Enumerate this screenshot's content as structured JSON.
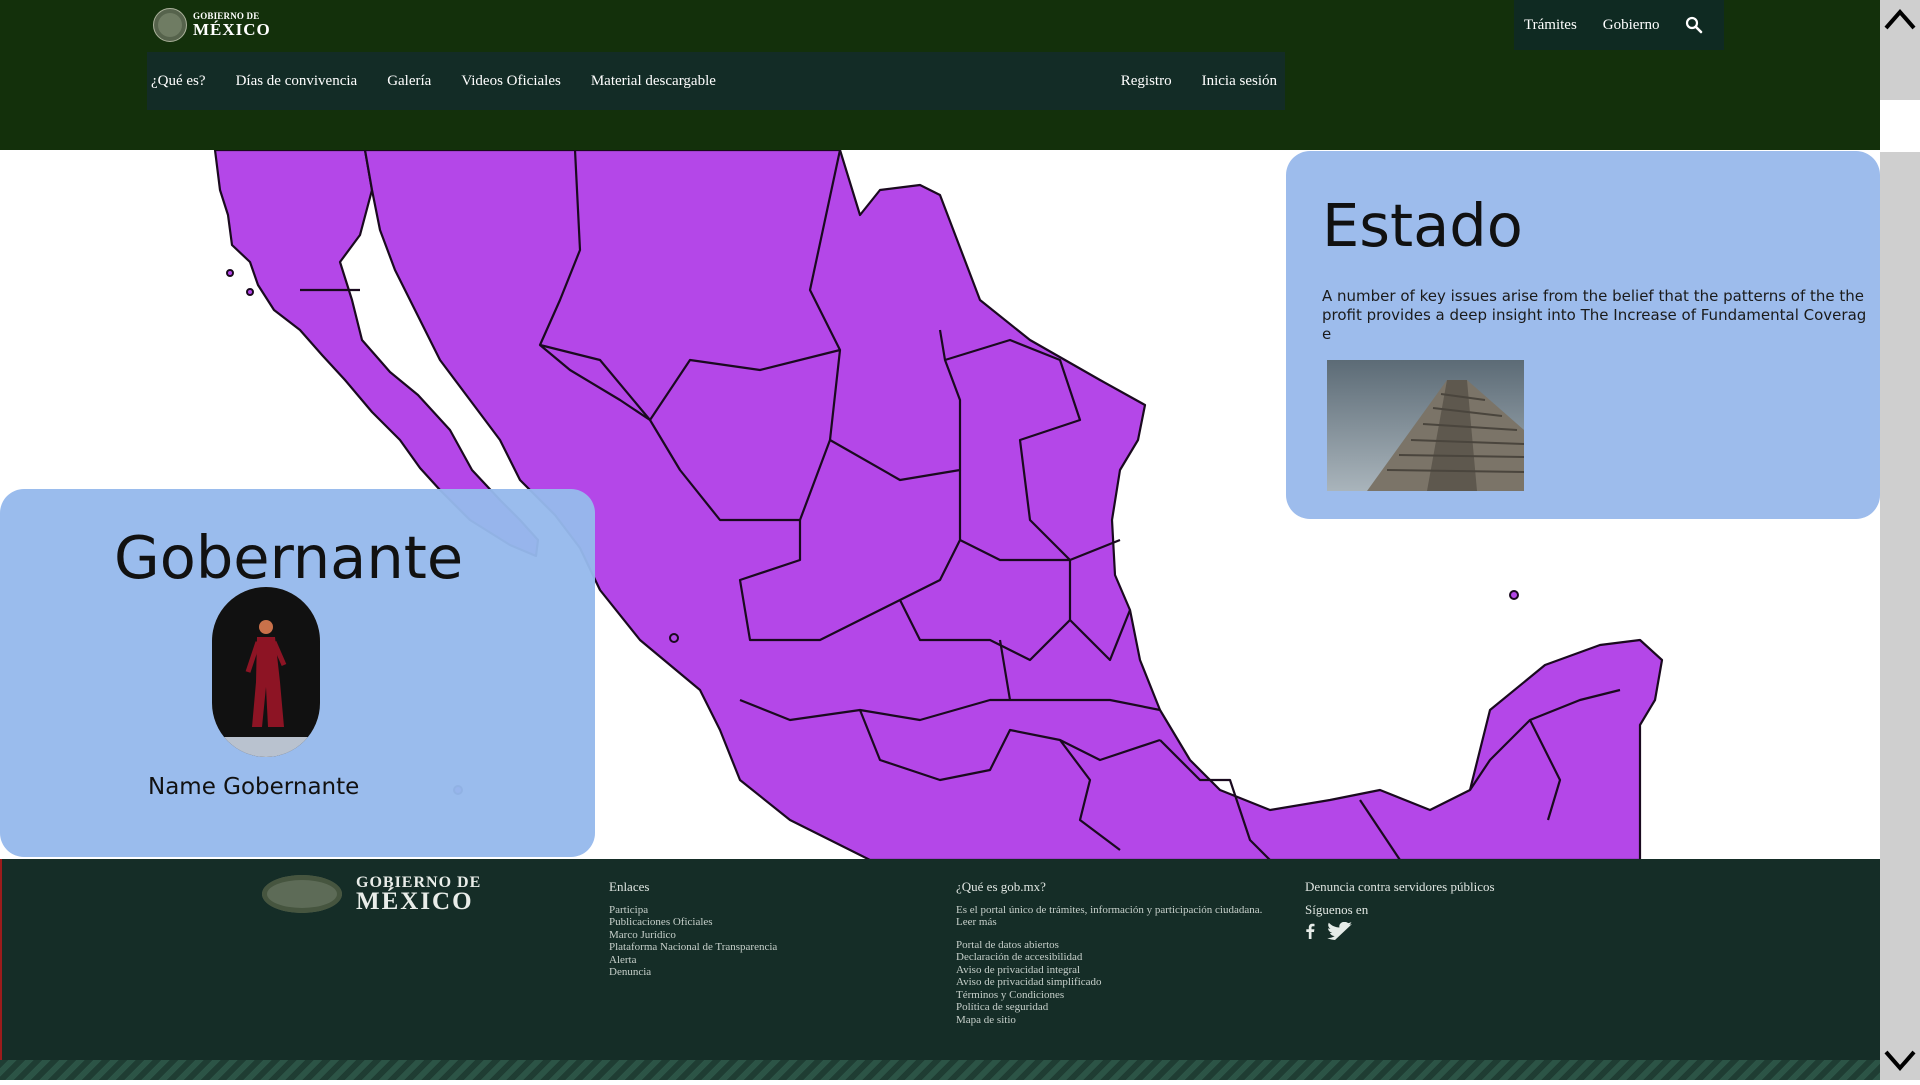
{
  "header": {
    "logo": {
      "line1": "GOBIERNO DE",
      "line2": "MÉXICO"
    },
    "top_links": [
      "Trámites",
      "Gobierno"
    ],
    "search_icon": "search-icon",
    "nav_left": [
      "¿Qué es?",
      "Días de convivencia",
      "Galería",
      "Videos Oficiales",
      "Material descargable"
    ],
    "nav_right": [
      "Registro",
      "Inicia sesión"
    ]
  },
  "colors": {
    "header_bg": "#13300b",
    "nav_bg": "#132c26",
    "map_fill": "#b447e8",
    "card_bg": "#9bbbea",
    "footer_bg": "#152d27"
  },
  "estado": {
    "title": "Estado",
    "description": "A number of key issues arise from the belief that the patterns of the the profit provides a deep insight into The Increase of Fundamental Coverage",
    "image": "pyramid-photo"
  },
  "gobernante": {
    "title": "Gobernante",
    "name": "Name Gobernante",
    "photo": "person-photo"
  },
  "footer": {
    "logo": {
      "line1": "GOBIERNO DE",
      "line2": "MÉXICO"
    },
    "enlaces": {
      "heading": "Enlaces",
      "items": [
        "Participa",
        "Publicaciones Oficiales",
        "Marco Jurídico",
        "Plataforma Nacional de Transparencia",
        "Alerta",
        "Denuncia"
      ]
    },
    "que_es": {
      "heading": "¿Qué es gob.mx?",
      "paragraph": "Es el portal único de trámites, información y participación ciudadana. Leer más",
      "items": [
        "Portal de datos abiertos",
        "Declaración de accesibilidad",
        "Aviso de privacidad integral",
        "Aviso de privacidad simplificado",
        "Términos y Condiciones",
        "Política de seguridad",
        "Mapa de sitio"
      ]
    },
    "denuncia": {
      "heading": "Denuncia contra servidores públicos",
      "follow": "Síguenos en",
      "social": [
        "facebook-icon",
        "twitter-icon"
      ]
    }
  }
}
